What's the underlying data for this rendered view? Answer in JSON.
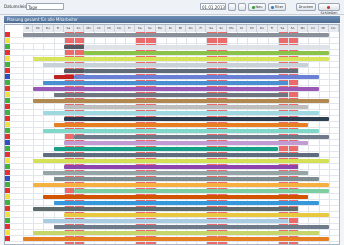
{
  "toolbar": {
    "view_label": "Datumsleiste",
    "view_value": "Tage",
    "date_value": "01.01.2013",
    "btn_new": "Neu",
    "btn_filter": "Filter",
    "btn_print": "Drucken",
    "btn_close": "Schließen"
  },
  "window_title": "Planung gesamt für alle Mitarbeiter",
  "colors": {
    "weekend": "#e85050",
    "grid_header": "#e7ebf0"
  },
  "column_days": [
    "Di",
    "Mi",
    "Do",
    "Fr",
    "Sa",
    "So",
    "Mo",
    "Di",
    "Mi",
    "Do",
    "Fr",
    "Sa",
    "So",
    "Mo",
    "Di",
    "Mi",
    "Do",
    "Fr",
    "Sa",
    "So",
    "Mo",
    "Di",
    "Mi",
    "Do",
    "Fr",
    "Sa",
    "So",
    "Mo",
    "Di",
    "Mi",
    "Do"
  ],
  "weekend_columns": [
    4,
    5,
    11,
    12,
    18,
    19,
    25,
    26
  ],
  "rows": [
    {
      "color": "#e53030",
      "label": "",
      "bars": [
        {
          "s": 0,
          "e": 30,
          "c": "#8a9099",
          "t": ""
        }
      ]
    },
    {
      "color": "#f0e040",
      "label": "",
      "bars": [
        {
          "s": 0,
          "e": 3,
          "c": "#ffffff",
          "t": ""
        }
      ]
    },
    {
      "color": "#40b040",
      "label": "",
      "bars": [
        {
          "s": 4,
          "e": 6,
          "c": "#555a62",
          "t": ""
        },
        {
          "s": 6,
          "e": 30,
          "c": "#dfe3e8",
          "t": ""
        }
      ]
    },
    {
      "color": "#e53030",
      "label": "",
      "bars": [
        {
          "s": 0,
          "e": 3,
          "c": "#ffffff",
          "t": ""
        },
        {
          "s": 6,
          "e": 30,
          "c": "#8bc34a",
          "t": ""
        }
      ]
    },
    {
      "color": "#f0e040",
      "label": "",
      "bars": [
        {
          "s": 1,
          "e": 30,
          "c": "#d8e45a",
          "t": ""
        }
      ]
    },
    {
      "color": "#40b040",
      "label": "",
      "bars": [
        {
          "s": 2,
          "e": 28,
          "c": "#c8d0d8",
          "t": ""
        }
      ]
    },
    {
      "color": "#e53030",
      "label": "",
      "bars": [
        {
          "s": 4,
          "e": 6,
          "c": "#555a62",
          "t": ""
        },
        {
          "s": 6,
          "e": 27,
          "c": "#5f6b78",
          "t": ""
        }
      ]
    },
    {
      "color": "#3050c0",
      "label": "",
      "bars": [
        {
          "s": 3,
          "e": 5,
          "c": "#c02020",
          "t": ""
        },
        {
          "s": 5,
          "e": 29,
          "c": "#6a7fd6",
          "t": ""
        }
      ]
    },
    {
      "color": "#40b040",
      "label": "",
      "bars": [
        {
          "s": 2,
          "e": 26,
          "c": "#4a90d0",
          "t": ""
        }
      ]
    },
    {
      "color": "#e53030",
      "label": "",
      "bars": [
        {
          "s": 1,
          "e": 29,
          "c": "#9b59b6",
          "t": ""
        }
      ]
    },
    {
      "color": "#f0e040",
      "label": "",
      "bars": [
        {
          "s": 3,
          "e": 26,
          "c": "#6d7580",
          "t": ""
        }
      ]
    },
    {
      "color": "#40b040",
      "label": "",
      "bars": [
        {
          "s": 1,
          "e": 30,
          "c": "#b08850",
          "t": ""
        }
      ]
    },
    {
      "color": "#e53030",
      "label": "",
      "bars": [
        {
          "s": 4,
          "e": 28,
          "c": "#bdbdbd",
          "t": ""
        }
      ]
    },
    {
      "color": "#40b040",
      "label": "",
      "bars": [
        {
          "s": 2,
          "e": 29,
          "c": "#a0d8e0",
          "t": ""
        }
      ]
    },
    {
      "color": "#e53030",
      "label": "",
      "bars": [
        {
          "s": 4,
          "e": 30,
          "c": "#2c3e50",
          "t": ""
        }
      ]
    },
    {
      "color": "#f0e040",
      "label": "",
      "bars": [
        {
          "s": 3,
          "e": 28,
          "c": "#e67e22",
          "t": ""
        }
      ]
    },
    {
      "color": "#40b040",
      "label": "",
      "bars": [
        {
          "s": 2,
          "e": 29,
          "c": "#7fd8c8",
          "t": ""
        }
      ]
    },
    {
      "color": "#e53030",
      "label": "",
      "bars": [
        {
          "s": 5,
          "e": 30,
          "c": "#6c7a89",
          "t": ""
        }
      ]
    },
    {
      "color": "#3050c0",
      "label": "",
      "bars": [
        {
          "s": 4,
          "e": 28,
          "c": "#c39bd3",
          "t": ""
        }
      ]
    },
    {
      "color": "#40b040",
      "label": "",
      "bars": [
        {
          "s": 3,
          "e": 25,
          "c": "#16a085",
          "t": ""
        }
      ]
    },
    {
      "color": "#e53030",
      "label": "",
      "bars": [
        {
          "s": 2,
          "e": 29,
          "c": "#5d6d7e",
          "t": ""
        }
      ]
    },
    {
      "color": "#f0e040",
      "label": "",
      "bars": [
        {
          "s": 1,
          "e": 30,
          "c": "#d4e157",
          "t": ""
        }
      ]
    },
    {
      "color": "#40b040",
      "label": "",
      "bars": [
        {
          "s": 4,
          "e": 27,
          "c": "#8e44ad",
          "t": ""
        }
      ]
    },
    {
      "color": "#e53030",
      "label": "",
      "bars": [
        {
          "s": 2,
          "e": 28,
          "c": "#95a5a6",
          "t": ""
        }
      ]
    },
    {
      "color": "#3050c0",
      "label": "",
      "bars": [
        {
          "s": 3,
          "e": 29,
          "c": "#7f8c8d",
          "t": ""
        }
      ]
    },
    {
      "color": "#40b040",
      "label": "",
      "bars": [
        {
          "s": 1,
          "e": 30,
          "c": "#f5b041",
          "t": ""
        }
      ]
    },
    {
      "color": "#e53030",
      "label": "",
      "bars": [
        {
          "s": 5,
          "e": 30,
          "c": "#7dcea0",
          "t": ""
        }
      ]
    },
    {
      "color": "#f0e040",
      "label": "",
      "bars": [
        {
          "s": 2,
          "e": 28,
          "c": "#d35400",
          "t": ""
        }
      ]
    },
    {
      "color": "#40b040",
      "label": "",
      "bars": [
        {
          "s": 3,
          "e": 29,
          "c": "#3498db",
          "t": ""
        }
      ]
    },
    {
      "color": "#e53030",
      "label": "",
      "bars": [
        {
          "s": 1,
          "e": 27,
          "c": "#5f6a6a",
          "t": ""
        }
      ]
    },
    {
      "color": "#f0e040",
      "label": "",
      "bars": [
        {
          "s": 4,
          "e": 30,
          "c": "#e8c840",
          "t": ""
        }
      ]
    },
    {
      "color": "#40b040",
      "label": "",
      "bars": [
        {
          "s": 2,
          "e": 26,
          "c": "#a9cce3",
          "t": ""
        }
      ]
    },
    {
      "color": "#e53030",
      "label": "",
      "bars": [
        {
          "s": 3,
          "e": 30,
          "c": "#6e7b8b",
          "t": ""
        }
      ]
    },
    {
      "color": "#f0e040",
      "label": "",
      "bars": [
        {
          "s": 1,
          "e": 29,
          "c": "#c7d66a",
          "t": ""
        }
      ]
    },
    {
      "color": "#e53030",
      "label": "",
      "bars": [
        {
          "s": 0,
          "e": 30,
          "c": "#e67e22",
          "t": ""
        }
      ]
    }
  ]
}
